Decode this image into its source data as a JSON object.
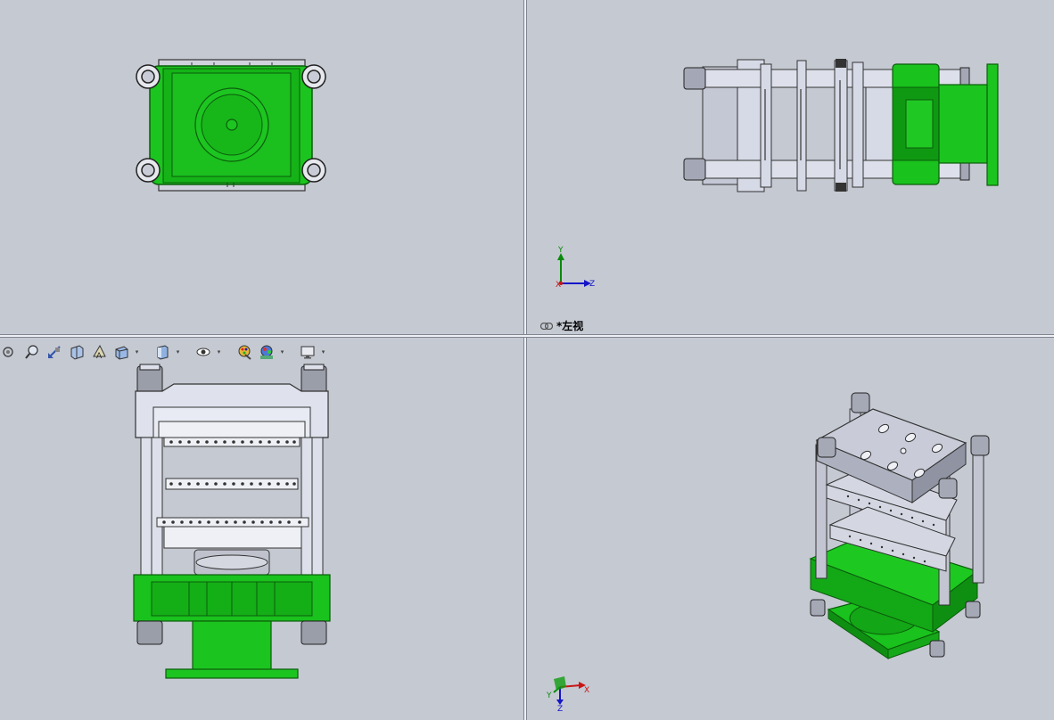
{
  "views": {
    "top_left": {
      "name": "front-view"
    },
    "top_right": {
      "name": "left-view",
      "label": "*左视"
    },
    "bottom_left": {
      "name": "top-view"
    },
    "bottom_right": {
      "name": "isometric-view"
    }
  },
  "toolbar": {
    "buttons": [
      {
        "icon": "zoom-to-fit-icon"
      },
      {
        "icon": "zoom-to-area-icon"
      },
      {
        "icon": "previous-view-icon"
      },
      {
        "icon": "section-view-icon"
      },
      {
        "icon": "dynamic-annotation-icon"
      },
      {
        "icon": "view-orientation-icon",
        "dropdown": true
      },
      {
        "icon": "display-style-icon",
        "dropdown": true
      },
      {
        "icon": "hide-show-items-icon",
        "dropdown": true
      },
      {
        "icon": "edit-appearance-icon"
      },
      {
        "icon": "apply-scene-icon",
        "dropdown": true
      },
      {
        "icon": "view-settings-icon",
        "dropdown": true
      }
    ]
  },
  "triad_front": {
    "y": "Y",
    "z": "Z",
    "x": "X"
  },
  "triad_iso": {
    "y": "Y",
    "z": "Z",
    "x": "X"
  },
  "colors": {
    "viewport_bg": "#c5c9d2",
    "part_green": "#19c21c",
    "part_dark_green": "#0b7d10",
    "metal_gray": "#d6d9e6",
    "metal_dark": "#6f7380"
  }
}
